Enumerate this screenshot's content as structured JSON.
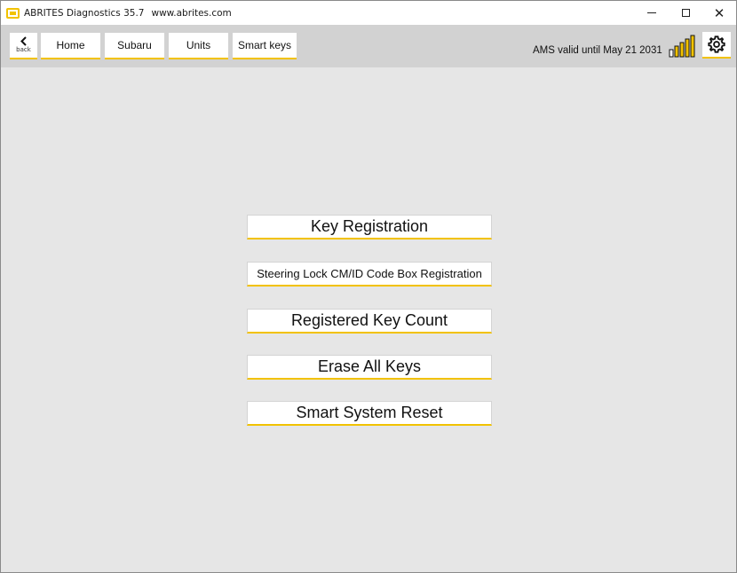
{
  "window": {
    "title": "ABRITES Diagnostics 35.7",
    "url": "www.abrites.com",
    "minimize_glyph": "–",
    "close_glyph": "✕"
  },
  "toolbar": {
    "back_label": "back",
    "back_glyph": "‹",
    "breadcrumbs": [
      "Home",
      "Subaru",
      "Units",
      "Smart keys"
    ],
    "ams_status": "AMS valid until May 21 2031",
    "signal_bars": 5,
    "settings_icon": "gear-icon"
  },
  "main": {
    "buttons": [
      "Key Registration",
      "Steering Lock CM/ID Code Box Registration",
      "Registered Key Count",
      "Erase All Keys",
      "Smart System Reset"
    ]
  },
  "colors": {
    "accent": "#f2c200",
    "background": "#e6e6e6",
    "toolbar": "#d2d2d2"
  }
}
